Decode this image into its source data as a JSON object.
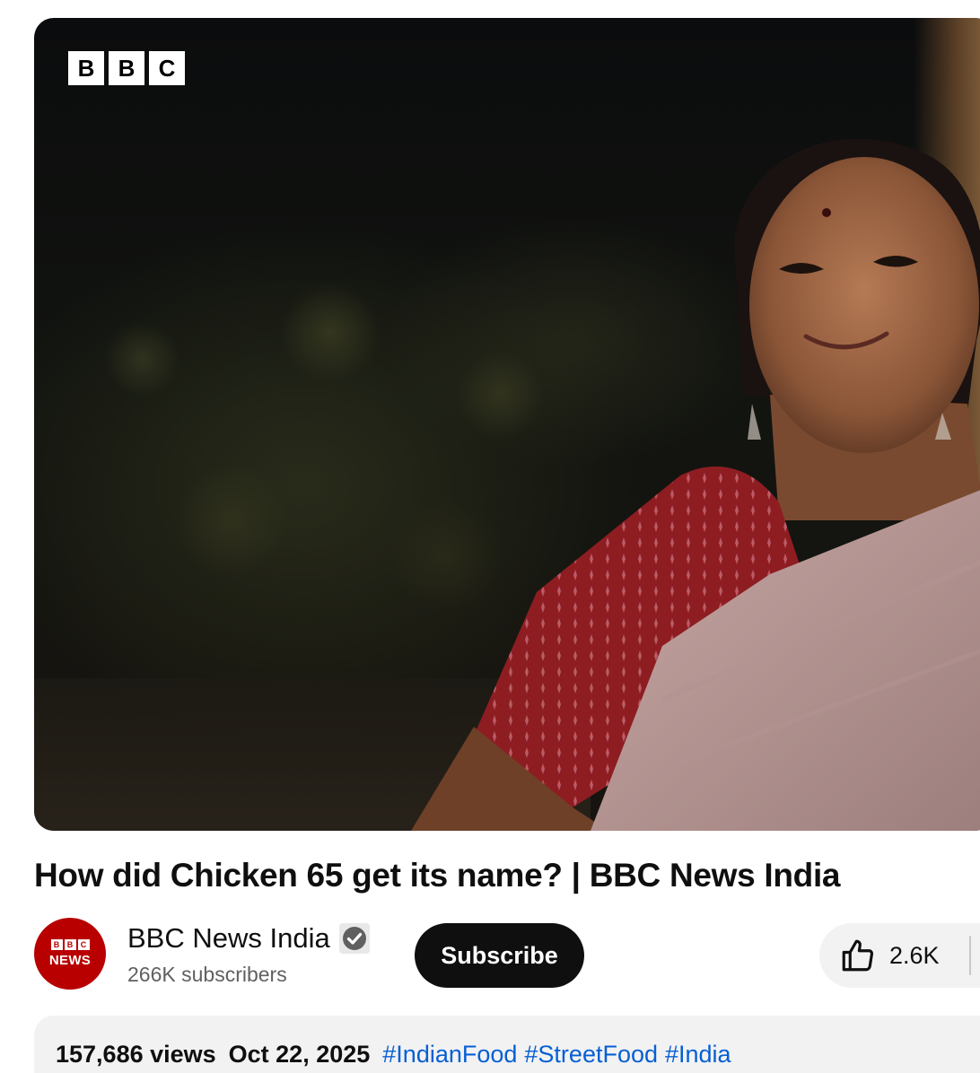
{
  "player": {
    "watermark_letters": [
      "B",
      "B",
      "C"
    ]
  },
  "video": {
    "title": "How did Chicken 65 get its name? | BBC News India"
  },
  "channel": {
    "name": "BBC News India",
    "subscribers": "266K subscribers",
    "avatar_text_top": [
      "B",
      "B",
      "C"
    ],
    "avatar_text_bottom": "NEWS",
    "avatar_color": "#b80000",
    "verified_icon": "verified-check-icon"
  },
  "actions": {
    "subscribe_label": "Subscribe",
    "like_count": "2.6K",
    "like_icon": "thumbs-up-icon"
  },
  "description": {
    "views": "157,686 views",
    "date": "Oct 22, 2025",
    "hashtags": [
      "#IndianFood",
      "#StreetFood",
      "#India"
    ]
  },
  "colors": {
    "subscribe_bg": "#0f0f0f",
    "link": "#065fd4",
    "pill_bg": "#f2f2f2"
  }
}
